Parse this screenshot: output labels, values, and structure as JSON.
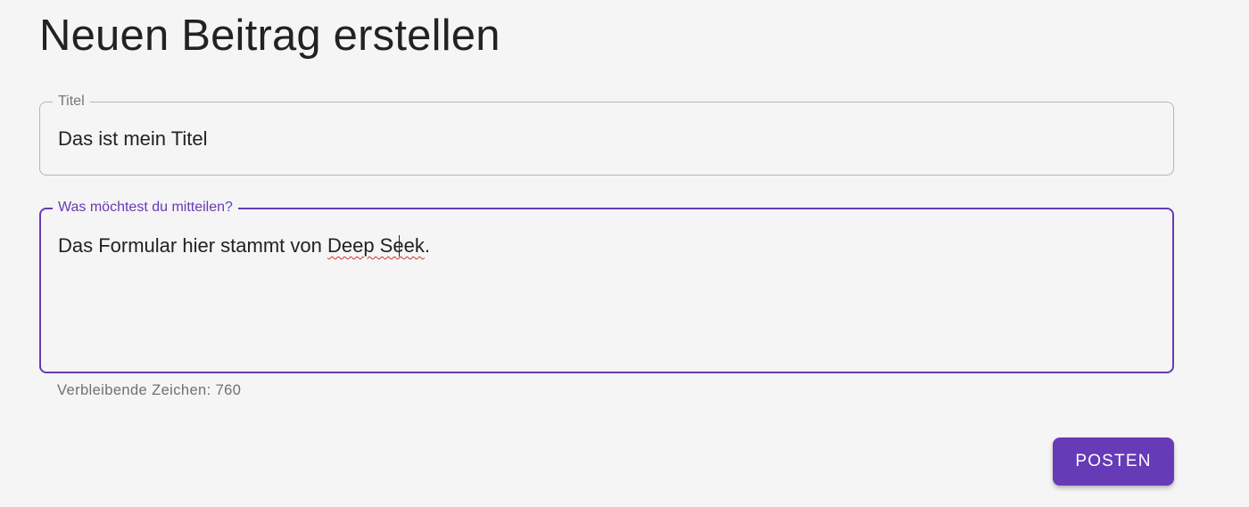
{
  "page": {
    "title": "Neuen Beitrag erstellen"
  },
  "form": {
    "title_field": {
      "label": "Titel",
      "value": "Das ist mein Titel"
    },
    "message_field": {
      "label": "Was möchtest du mitteilen?",
      "value_before_flag": "Das Formular hier stammt von ",
      "value_flagged": "Deep Seek",
      "value_after_flag": ".",
      "helper_text": "Verbleibende Zeichen: 760"
    },
    "submit_label": "POSTEN"
  },
  "colors": {
    "accent": "#673ab7",
    "background": "#f5f5f5",
    "inactive_border": "#b5b5b5",
    "spellcheck": "#d32f2f"
  }
}
